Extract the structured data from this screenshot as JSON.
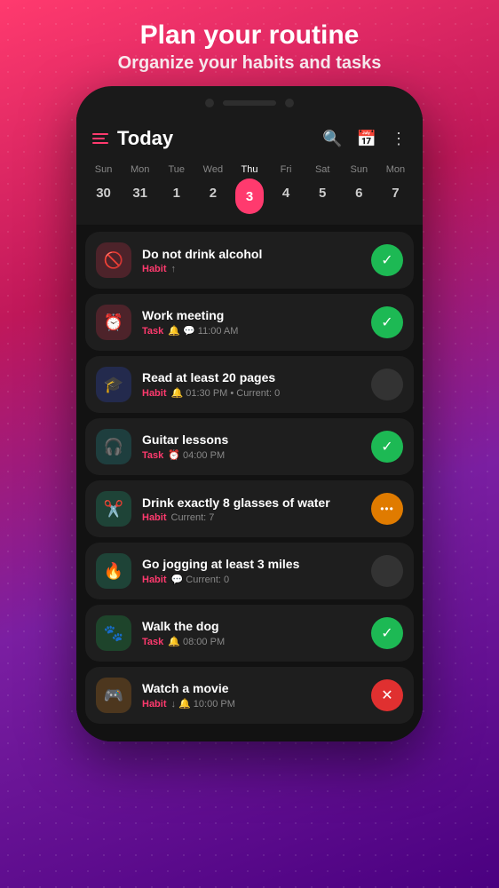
{
  "hero": {
    "title": "Plan your routine",
    "subtitle": "Organize your habits and tasks"
  },
  "header": {
    "title": "Today",
    "search_label": "search",
    "calendar_label": "calendar",
    "menu_label": "more"
  },
  "calendar": {
    "days": [
      {
        "name": "Sun",
        "num": "30",
        "active": false
      },
      {
        "name": "Mon",
        "num": "31",
        "active": false
      },
      {
        "name": "Tue",
        "num": "1",
        "active": false
      },
      {
        "name": "Wed",
        "num": "2",
        "active": false
      },
      {
        "name": "Thu",
        "num": "3",
        "active": true
      },
      {
        "name": "Fri",
        "num": "4",
        "active": false
      },
      {
        "name": "Sat",
        "num": "5",
        "active": false
      },
      {
        "name": "Sun",
        "num": "6",
        "active": false
      },
      {
        "name": "Mon",
        "num": "7",
        "active": false
      }
    ]
  },
  "tasks": [
    {
      "id": 1,
      "icon": "🚫",
      "icon_bg": "bg-red",
      "title": "Do not drink alcohol",
      "type": "Habit",
      "type_class": "habit",
      "meta": "↑",
      "action": "done",
      "action_icon": "✓"
    },
    {
      "id": 2,
      "icon": "⏰",
      "icon_bg": "bg-pink",
      "title": "Work meeting",
      "type": "Task",
      "type_class": "task",
      "meta": "🔔 💬 11:00 AM",
      "action": "done",
      "action_icon": "✓"
    },
    {
      "id": 3,
      "icon": "🎓",
      "icon_bg": "bg-blue",
      "title": "Read at least 20 pages",
      "type": "Habit",
      "type_class": "habit",
      "meta": "🔔 01:30 PM • Current: 0",
      "action": "pending",
      "action_icon": ""
    },
    {
      "id": 4,
      "icon": "🎧",
      "icon_bg": "bg-teal",
      "title": "Guitar lessons",
      "type": "Task",
      "type_class": "task",
      "meta": "⏰ 04:00 PM",
      "action": "done",
      "action_icon": "✓"
    },
    {
      "id": 5,
      "icon": "✂️",
      "icon_bg": "bg-teal2",
      "title": "Drink exactly 8 glasses of water",
      "type": "Habit",
      "type_class": "habit",
      "meta": "Current: 7",
      "action": "orange",
      "action_icon": "···"
    },
    {
      "id": 6,
      "icon": "🔥",
      "icon_bg": "bg-teal2",
      "title": "Go jogging at least 3 miles",
      "type": "Habit",
      "type_class": "habit",
      "meta": "💬 Current: 0",
      "action": "pending",
      "action_icon": ""
    },
    {
      "id": 7,
      "icon": "🐾",
      "icon_bg": "bg-green",
      "title": "Walk the dog",
      "type": "Task",
      "type_class": "task",
      "meta": "🔔 08:00 PM",
      "action": "done",
      "action_icon": "✓"
    },
    {
      "id": 8,
      "icon": "🎮",
      "icon_bg": "bg-orange",
      "title": "Watch a movie",
      "type": "Habit",
      "type_class": "habit",
      "meta": "↓ 🔔 10:00 PM",
      "action": "red",
      "action_icon": "✕"
    }
  ]
}
